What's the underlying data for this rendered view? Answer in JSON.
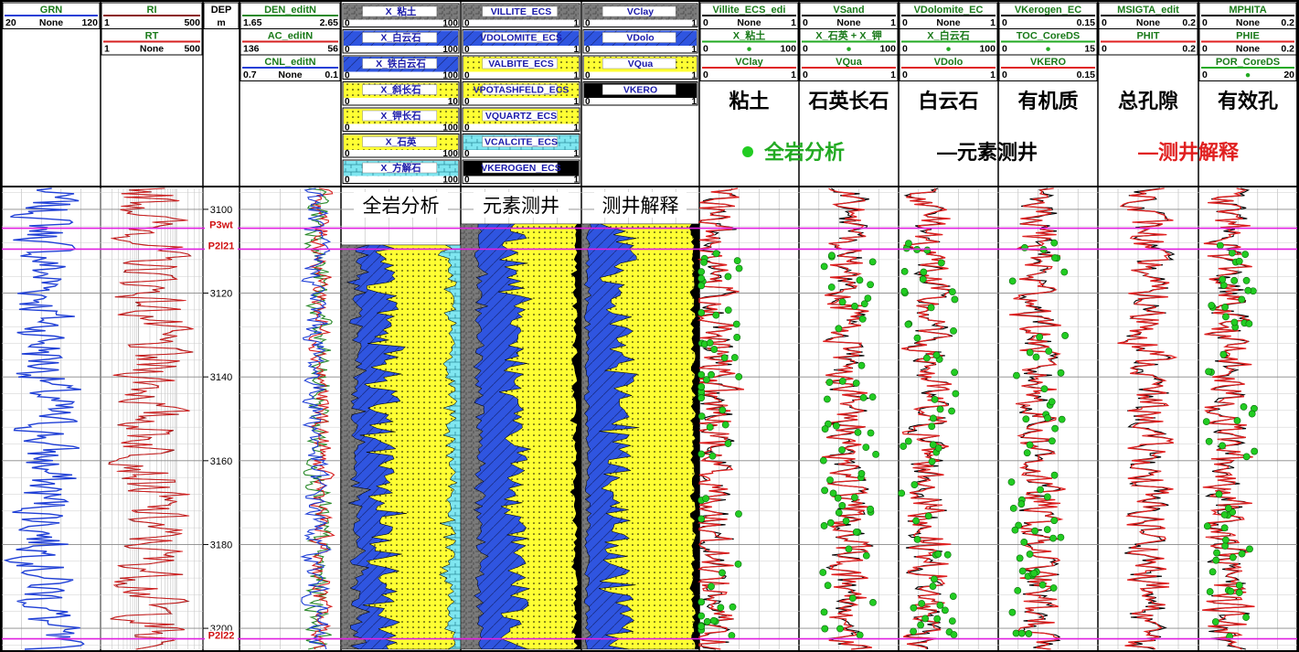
{
  "chart_data": {
    "type": "well-log",
    "depth": {
      "mnemonic": "DEP",
      "unit": "m",
      "range": [
        3095,
        3205
      ],
      "ticks": [
        3100,
        3120,
        3140,
        3160,
        3180,
        3200
      ]
    },
    "formation_tops": [
      {
        "name": "P3wt",
        "depth": 3104.5
      },
      {
        "name": "P2l21",
        "depth": 3109.5
      },
      {
        "name": "P2l22",
        "depth": 3202.5
      }
    ],
    "column_headers": [
      [
        {
          "name": "GRN",
          "min": "20",
          "mid": "None",
          "max": "120",
          "color": "#1f3fd6"
        }
      ],
      [
        {
          "name": "RI",
          "min": "1",
          "mid": "",
          "max": "500",
          "color": "#8b1a1a"
        },
        {
          "name": "RT",
          "min": "1",
          "mid": "None",
          "max": "500",
          "color": "#d62020"
        }
      ],
      [
        {
          "name": "DEP",
          "min": "",
          "mid": "m",
          "max": "",
          "color": "#000000"
        }
      ],
      [
        {
          "name": "DEN_editN",
          "min": "1.65",
          "mid": "",
          "max": "2.65",
          "color": "#2a8a2a"
        },
        {
          "name": "AC_editN",
          "min": "136",
          "mid": "",
          "max": "56",
          "color": "#d62020"
        },
        {
          "name": "CNL_editN",
          "min": "0.7",
          "mid": "None",
          "max": "0.1",
          "color": "#1f3fd6"
        }
      ],
      [
        {
          "name": "X_粘土",
          "min": "0",
          "mid": "",
          "max": "100",
          "fill": "#777777"
        },
        {
          "name": "X_白云石",
          "min": "0",
          "mid": "",
          "max": "100",
          "fill": "#2f55e0"
        },
        {
          "name": "X_铁白云石",
          "min": "0",
          "mid": "",
          "max": "100",
          "fill": "#2f55e0"
        },
        {
          "name": "X_斜长石",
          "min": "0",
          "mid": "",
          "max": "10",
          "fill": "#ffff33"
        },
        {
          "name": "X_钾长石",
          "min": "0",
          "mid": "",
          "max": "100",
          "fill": "#ffff33"
        },
        {
          "name": "X_石英",
          "min": "0",
          "mid": "",
          "max": "100",
          "fill": "#ffff33"
        },
        {
          "name": "X_方解石",
          "min": "0",
          "mid": "",
          "max": "100",
          "fill": "#7fe6f0"
        }
      ],
      [
        {
          "name": "VILLITE_ECS",
          "min": "0",
          "mid": "",
          "max": "1",
          "fill": "#777777"
        },
        {
          "name": "VDOLOMITE_ECS",
          "min": "0",
          "mid": "",
          "max": "1",
          "fill": "#2f55e0"
        },
        {
          "name": "VALBITE_ECS",
          "min": "0",
          "mid": "",
          "max": "1",
          "fill": "#ffff33"
        },
        {
          "name": "VPOTASHFELD_ECS",
          "min": "0",
          "mid": "",
          "max": "1",
          "fill": "#ffff33"
        },
        {
          "name": "VQUARTZ_ECS",
          "min": "0",
          "mid": "",
          "max": "1",
          "fill": "#ffff33"
        },
        {
          "name": "VCALCITE_ECS",
          "min": "0",
          "mid": "",
          "max": "1",
          "fill": "#7fe6f0"
        },
        {
          "name": "VKEROGEN_ECS",
          "min": "0",
          "mid": "",
          "max": "1",
          "fill": "#000000"
        }
      ],
      [
        {
          "name": "VClay",
          "min": "0",
          "mid": "",
          "max": "1",
          "fill": "#777777"
        },
        {
          "name": "VDolo",
          "min": "0",
          "mid": "",
          "max": "1",
          "fill": "#2f55e0"
        },
        {
          "name": "VQua",
          "min": "0",
          "mid": "",
          "max": "1",
          "fill": "#ffff33"
        },
        {
          "name": "VKERO",
          "min": "0",
          "mid": "",
          "max": "1",
          "fill": "#000000"
        }
      ],
      [
        {
          "name": "Villite_ECS_edi",
          "min": "0",
          "mid": "None",
          "max": "1",
          "color": "#000000"
        },
        {
          "name": "X_粘土",
          "min": "0",
          "mid": "●",
          "max": "100",
          "color": "#22aa22"
        },
        {
          "name": "VClay",
          "min": "0",
          "mid": "",
          "max": "1",
          "color": "#e02020"
        }
      ],
      [
        {
          "name": "VSand",
          "min": "0",
          "mid": "None",
          "max": "1",
          "color": "#000000"
        },
        {
          "name": "X_石英 + X_钾",
          "min": "0",
          "mid": "●",
          "max": "100",
          "color": "#22aa22"
        },
        {
          "name": "VQua",
          "min": "0",
          "mid": "",
          "max": "1",
          "color": "#e02020"
        }
      ],
      [
        {
          "name": "VDolomite_EC",
          "min": "0",
          "mid": "None",
          "max": "1",
          "color": "#000000"
        },
        {
          "name": "X_白云石",
          "min": "0",
          "mid": "●",
          "max": "100",
          "color": "#22aa22"
        },
        {
          "name": "VDolo",
          "min": "0",
          "mid": "",
          "max": "1",
          "color": "#e02020"
        }
      ],
      [
        {
          "name": "VKerogen_EC",
          "min": "0",
          "mid": "",
          "max": "0.15",
          "color": "#000000"
        },
        {
          "name": "TOC_CoreDS",
          "min": "0",
          "mid": "●",
          "max": "15",
          "color": "#22aa22"
        },
        {
          "name": "VKERO",
          "min": "0",
          "mid": "",
          "max": "0.15",
          "color": "#e02020"
        }
      ],
      [
        {
          "name": "MSIGTA_edit",
          "min": "0",
          "mid": "None",
          "max": "0.2",
          "color": "#000000"
        },
        {
          "name": "PHIT",
          "min": "0",
          "mid": "",
          "max": "0.2",
          "color": "#e02020"
        }
      ],
      [
        {
          "name": "MPHITA",
          "min": "0",
          "mid": "None",
          "max": "0.2",
          "color": "#000000"
        },
        {
          "name": "PHIE",
          "min": "0",
          "mid": "None",
          "max": "0.2",
          "color": "#e02020"
        },
        {
          "name": "POR_CoreDS",
          "min": "0",
          "mid": "●",
          "max": "20",
          "color": "#22aa22"
        }
      ]
    ],
    "labels": {
      "col7": "粘土",
      "col8": "石英长石",
      "col9": "白云石",
      "col10": "有机质",
      "col11": "总孔隙",
      "col12": "有效孔",
      "legend_core": "全岩分析",
      "legend_ecs": "—元素测井",
      "legend_interp": "—测井解释",
      "track_core": "全岩分析",
      "track_ecs": "元素测井",
      "track_interp": "测井解释"
    },
    "legend": {
      "placement": "header-right"
    },
    "colors": {
      "gr": "#1f3fd6",
      "res": "#8b1a1a",
      "ac": "#d62020",
      "den": "#2a8a2a",
      "cnl": "#1f3fd6",
      "clay": "#777777",
      "dolo": "#2f55e0",
      "quartz": "#ffff33",
      "calcite": "#7fe6f0",
      "kero": "#000000",
      "core": "#22cc22",
      "ecs": "#000000",
      "interp": "#e02020",
      "top": "#e020e0"
    },
    "grid": true
  }
}
